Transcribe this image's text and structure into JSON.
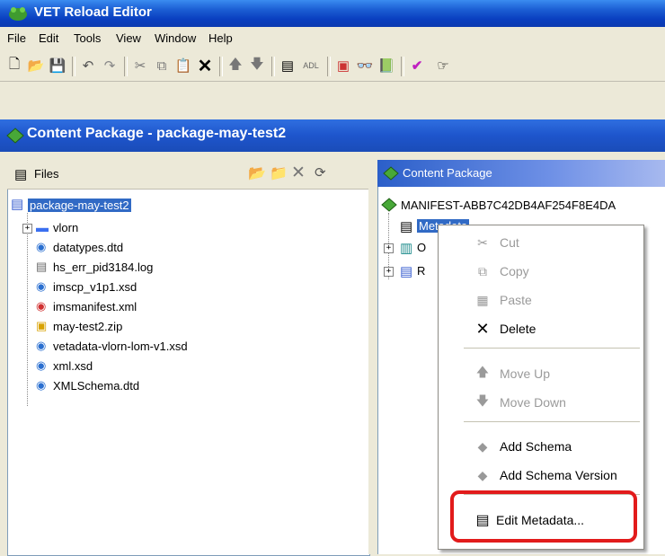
{
  "window": {
    "title": "VET Reload Editor",
    "app_icon": "frog-icon"
  },
  "menubar": [
    "File",
    "Edit",
    "Tools",
    "View",
    "Window",
    "Help"
  ],
  "toolbar": {
    "buttons": [
      "new-icon",
      "open-icon",
      "save-icon",
      "undo-icon",
      "redo-icon",
      "cut-icon",
      "copy-icon",
      "paste-icon",
      "delete-icon",
      "move-up-icon",
      "move-down-icon",
      "metadata-icon",
      "adl-icon",
      "validate-icon",
      "preview-icon",
      "book-icon",
      "check-icon",
      "pointer-icon"
    ],
    "adl_label": "ADL"
  },
  "package_frame": {
    "title": "Content Package - package-may-test2"
  },
  "files_panel": {
    "title": "Files",
    "root": "package-may-test2",
    "items": [
      {
        "name": "vlorn",
        "type": "folder"
      },
      {
        "name": "datatypes.dtd",
        "type": "schema"
      },
      {
        "name": "hs_err_pid3184.log",
        "type": "text"
      },
      {
        "name": "imscp_v1p1.xsd",
        "type": "schema"
      },
      {
        "name": "imsmanifest.xml",
        "type": "xml"
      },
      {
        "name": "may-test2.zip",
        "type": "zip"
      },
      {
        "name": "vetadata-vlorn-lom-v1.xsd",
        "type": "schema"
      },
      {
        "name": "xml.xsd",
        "type": "schema"
      },
      {
        "name": "XMLSchema.dtd",
        "type": "schema"
      }
    ]
  },
  "content_panel": {
    "title": "Content Package",
    "manifest": "MANIFEST-ABB7C42DB4AF254F8E4DA",
    "children": [
      {
        "label": "Metadata",
        "selected": true
      },
      {
        "label": "O"
      },
      {
        "label": "R"
      }
    ]
  },
  "context_menu": {
    "items": [
      {
        "label": "Cut",
        "icon": "scissors-icon",
        "enabled": false
      },
      {
        "label": "Copy",
        "icon": "copy-icon",
        "enabled": false
      },
      {
        "label": "Paste",
        "icon": "paste-icon",
        "enabled": false
      },
      {
        "label": "Delete",
        "icon": "delete-icon",
        "enabled": true
      },
      {
        "label": "Move Up",
        "icon": "arrow-up-icon",
        "enabled": false
      },
      {
        "label": "Move Down",
        "icon": "arrow-down-icon",
        "enabled": false
      },
      {
        "label": "Add Schema",
        "icon": "diamond-icon",
        "enabled": true
      },
      {
        "label": "Add Schema Version",
        "icon": "diamond-icon",
        "enabled": true
      },
      {
        "label": "Edit Metadata...",
        "icon": "metadata-icon",
        "enabled": true,
        "highlighted": true
      }
    ]
  },
  "colors": {
    "title_blue": "#0a3fc0",
    "selection": "#316ac5",
    "highlight_box": "#e21b1b"
  }
}
